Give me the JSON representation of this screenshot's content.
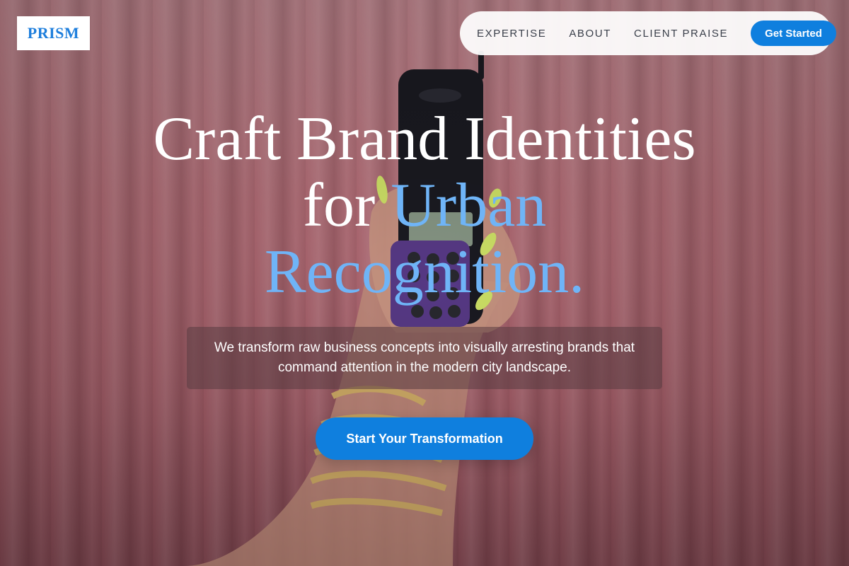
{
  "brand": {
    "logo_text": "PRISM"
  },
  "nav": {
    "links": [
      "EXPERTISE",
      "ABOUT",
      "CLIENT PRAISE"
    ],
    "cta_label": "Get Started"
  },
  "hero": {
    "headline_line1": "Craft Brand Identities",
    "headline_for": "for ",
    "headline_accent1": "Urban",
    "headline_accent2": "Recognition.",
    "subtitle": "We transform raw business concepts into visually arresting brands that command attention in the modern city landscape.",
    "cta_label": "Start Your Transformation"
  },
  "colors": {
    "accent": "#0f7fde",
    "headline_accent": "#6fb4f7",
    "logo_text": "#1f7fdc"
  }
}
